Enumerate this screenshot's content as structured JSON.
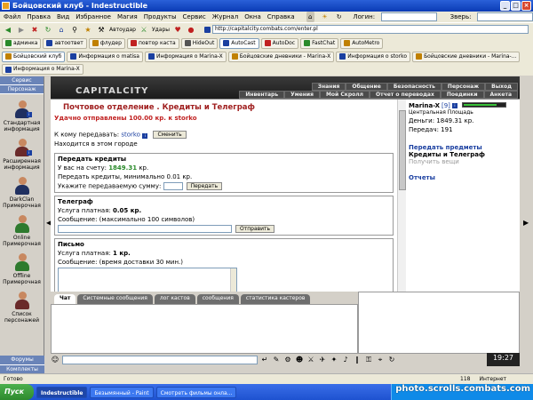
{
  "window": {
    "title": "Бойцовский клуб - Indestructible"
  },
  "menu": [
    "Файл",
    "Правка",
    "Вид",
    "Избранное",
    "Магия",
    "Продукты",
    "Сервис",
    "Журнал",
    "Окна",
    "Справка"
  ],
  "toolbar": {
    "autoudar": "Автоудар",
    "udary": "Удары",
    "login_label": "Логин:",
    "zver_label": "Зверь:",
    "address": "http://capitalcity.combats.com/enter.pl"
  },
  "tabs_row1": [
    "админка",
    "автоответ",
    "флудер",
    "повтор каста",
    "HideOut",
    "AutoCast",
    "AutoDoc",
    "FastChat",
    "AutoMetro"
  ],
  "tabs_row2": [
    "Бойцовский клуб",
    "Информация о matisa",
    "Информация о Marina-X",
    "Бойцовские дневники - Marina-X",
    "Информация о storko",
    "Бойцовские дневники - Marina-..."
  ],
  "tabs_row3": [
    "Информация о Marina-X"
  ],
  "left_panel": {
    "head1": "Сервис",
    "head2": "Персонаж",
    "items": [
      "Стандартная информация",
      "Расширенная информация",
      "DarkClan Примерочная",
      "Online Примерочная",
      "Offline Примерочная",
      "Список персонажей"
    ],
    "foot1": "Форумы",
    "foot2": "Комплекты"
  },
  "game": {
    "logo": "CAPITALCITY",
    "nav_top": [
      "Знания",
      "Общение",
      "Безопасность",
      "Персонаж",
      "Выход"
    ],
    "nav_bottom": [
      "Инвентарь",
      "Умения",
      "Мой Скролл",
      "Отчет о переводах",
      "Поединки",
      "Анкета"
    ]
  },
  "main": {
    "title": "Почтовое отделение .  Кредиты и Телеграф",
    "success": "Удачно отправлены 100.00 кр. к storko",
    "recipient_label": "К кому передавать:",
    "recipient_name": "storko",
    "change_btn": "Сменить",
    "same_city": "Находится в этом городе",
    "credits": {
      "header": "Передать кредиты",
      "balance_prefix": "У вас на счету:",
      "balance_value": "1849.31",
      "balance_suffix": "кр.",
      "min_note": "Передать кредиты, минимально 0.01 кр.",
      "amount_label": "Укажите передаваемую сумму:",
      "submit": "Передать"
    },
    "telegraph": {
      "header": "Телеграф",
      "cost_prefix": "Услуга платная:",
      "cost_value": "0.05 кр.",
      "msg_label": "Сообщение: (максимально 100 символов)",
      "submit": "Отправить"
    },
    "letter": {
      "header": "Письмо",
      "cost_prefix": "Услуга платная:",
      "cost_value": "1 кр.",
      "msg_label": "Сообщение: (время доставки 30 мин.)"
    }
  },
  "right": {
    "char_name": "Marina-X",
    "char_level": "[9]",
    "location": "Центральная Площадь",
    "money": "Деньги: 1849.31 кр.",
    "transfers": "Передач: 191",
    "hp_fraction": 0.8,
    "link_items": "Передать предметы",
    "link_credits": "Кредиты и Телеграф",
    "link_gifts": "Получить вещи",
    "link_reports": "Отчеты"
  },
  "chat_tabs": [
    "Чат",
    "Системные сообщения",
    "лог кастов",
    "сообщения",
    "статистика кастеров"
  ],
  "clock": "19:27",
  "status": {
    "left": "Готово",
    "count": "118",
    "zone": "Интернет"
  },
  "taskbar": {
    "start": "Пуск",
    "tasks": [
      "Indestructible",
      "Безымянный - Paint",
      "Смотреть фильмы онла..."
    ],
    "watermark": "photo.scrolls.combats.com"
  }
}
